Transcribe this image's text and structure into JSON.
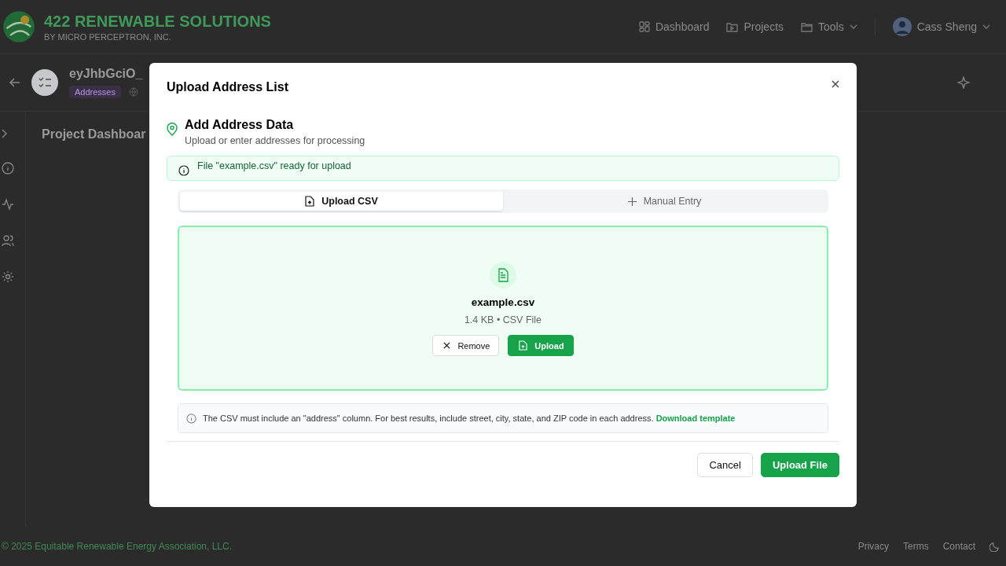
{
  "header": {
    "brand": "422 RENEWABLE SOLUTIONS",
    "tagline": "BY MICRO PERCEPTRON, INC.",
    "nav": [
      {
        "label": "Dashboard",
        "dropdown": false
      },
      {
        "label": "Projects",
        "dropdown": false
      },
      {
        "label": "Tools",
        "dropdown": true
      }
    ],
    "user": {
      "name": "Cass Sheng"
    }
  },
  "project": {
    "title": "eyJhbGciO_",
    "badge": "Addresses"
  },
  "main": {
    "heading": "Project Dashboar"
  },
  "footer": {
    "copyright": "© 2025 Equitable Renewable Energy Association, LLC.",
    "links": [
      "Privacy",
      "Terms",
      "Contact"
    ]
  },
  "dialog": {
    "title": "Upload Address List",
    "section_title": "Add Address Data",
    "section_subtitle": "Upload or enter addresses for processing",
    "alert": "File \"example.csv\" ready for upload",
    "tabs": [
      {
        "label": "Upload CSV",
        "selected": true
      },
      {
        "label": "Manual Entry",
        "selected": false
      }
    ],
    "file": {
      "name": "example.csv",
      "meta": "1.4 KB • CSV File"
    },
    "file_actions": [
      {
        "label": "Remove",
        "kind": "secondary"
      },
      {
        "label": "Upload",
        "kind": "primary"
      }
    ],
    "note": "The CSV must include an \"address\" column. For best results, include street, city, state, and ZIP code in each address.",
    "note_link": "Download template",
    "buttons": [
      {
        "label": "Cancel",
        "kind": "secondary"
      },
      {
        "label": "Upload File",
        "kind": "primary"
      }
    ]
  }
}
